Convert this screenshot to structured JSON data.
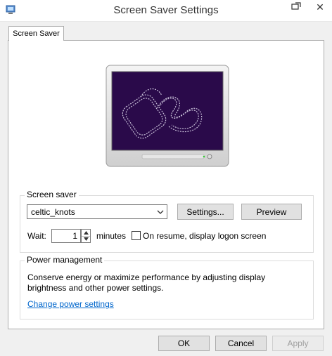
{
  "window": {
    "title": "Screen Saver Settings",
    "close_glyph": "✕"
  },
  "tabs": [
    {
      "label": "Screen Saver",
      "selected": true
    }
  ],
  "screen_saver": {
    "group_label": "Screen saver",
    "selected": "celtic_knots",
    "settings_label": "Settings...",
    "preview_label": "Preview",
    "wait_label": "Wait:",
    "wait_value": "1",
    "minutes_label": "minutes",
    "resume_label": "On resume, display logon screen",
    "resume_checked": false
  },
  "power": {
    "group_label": "Power management",
    "description": "Conserve energy or maximize performance by adjusting display brightness and other power settings.",
    "link_label": "Change power settings"
  },
  "footer": {
    "ok_label": "OK",
    "cancel_label": "Cancel",
    "apply_label": "Apply"
  },
  "colors": {
    "preview_screen": "#2a0a4a",
    "link": "#0066cc"
  }
}
